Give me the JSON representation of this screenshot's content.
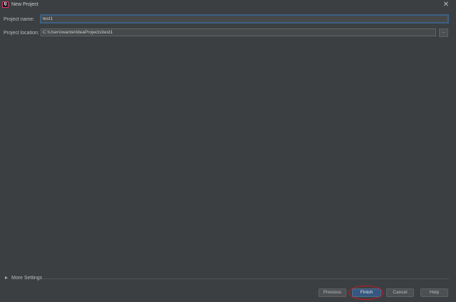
{
  "window": {
    "title": "New Project",
    "app_icon": "intellij-idea-icon",
    "app_icon_text": "IJ",
    "close_glyph": "✕"
  },
  "form": {
    "project_name_label": "Project name:",
    "project_name_value": "test1",
    "project_location_label": "Project location:",
    "project_location_value": "C:\\Users\\wante\\IdeaProjects\\test1",
    "browse_label": "..."
  },
  "more_settings": {
    "label": "More Settings",
    "expanded": false
  },
  "buttons": {
    "previous": "Previous",
    "finish": "Finish",
    "cancel": "Cancel",
    "help": "Help"
  },
  "colors": {
    "background": "#3c3f41",
    "primary_button": "#365880",
    "annotation": "#c21a2c"
  }
}
